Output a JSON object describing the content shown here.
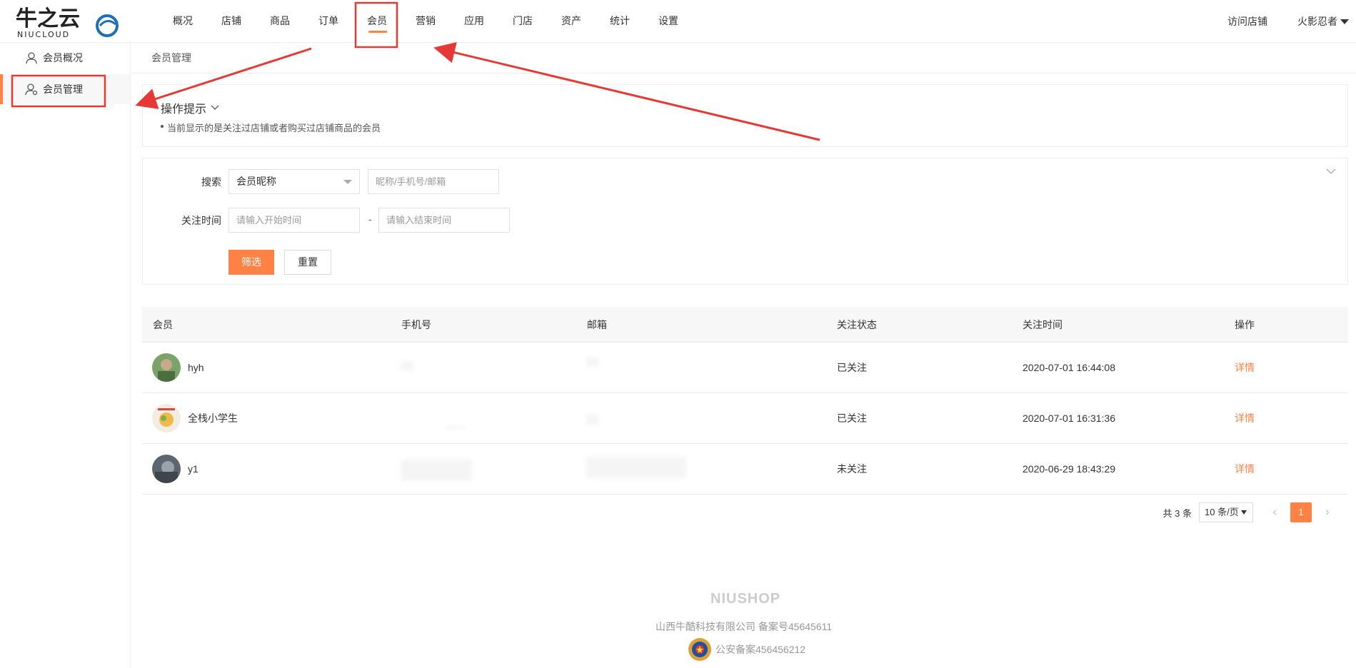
{
  "logo": {
    "brand_cn": "牛之云",
    "brand_en": "NIUCLOUD"
  },
  "nav": {
    "items": [
      {
        "label": "概况"
      },
      {
        "label": "店铺"
      },
      {
        "label": "商品"
      },
      {
        "label": "订单"
      },
      {
        "label": "会员",
        "active": true
      },
      {
        "label": "营销"
      },
      {
        "label": "应用"
      },
      {
        "label": "门店"
      },
      {
        "label": "资产"
      },
      {
        "label": "统计"
      },
      {
        "label": "设置"
      }
    ],
    "visit_store": "访问店铺",
    "user_name": "火影忍者"
  },
  "sidebar": {
    "items": [
      {
        "label": "会员概况"
      },
      {
        "label": "会员管理",
        "active": true
      }
    ]
  },
  "breadcrumb": "会员管理",
  "tips": {
    "title": "操作提示",
    "text": "当前显示的是关注过店铺或者购买过店铺商品的会员"
  },
  "search": {
    "search_label": "搜索",
    "search_type_value": "会员昵称",
    "keyword_placeholder": "昵称/手机号/邮箱",
    "time_label": "关注时间",
    "start_placeholder": "请输入开始时间",
    "range_sep": "-",
    "end_placeholder": "请输入结束时间",
    "filter_button": "筛选",
    "reset_button": "重置"
  },
  "table": {
    "headers": [
      "会员",
      "手机号",
      "邮箱",
      "关注状态",
      "关注时间",
      "操作"
    ],
    "rows": [
      {
        "name": "hyh",
        "status": "已关注",
        "time": "2020-07-01 16:44:08",
        "action": "详情"
      },
      {
        "name": "全栈小学生",
        "status": "已关注",
        "time": "2020-07-01 16:31:36",
        "action": "详情"
      },
      {
        "name": "y1",
        "status": "未关注",
        "time": "2020-06-29 18:43:29",
        "action": "详情"
      }
    ]
  },
  "pagination": {
    "total": "共 3 条",
    "page_size": "10 条/页",
    "current_page": "1",
    "prev": "‹",
    "next": "›"
  },
  "footer": {
    "brand": "NIUSHOP",
    "company": "山西牛酷科技有限公司  备案号45645611",
    "police": "公安备案456456212"
  },
  "colors": {
    "accent": "#ff8143",
    "annotation": "#e53935",
    "logo_blue": "#1f6fb5"
  }
}
